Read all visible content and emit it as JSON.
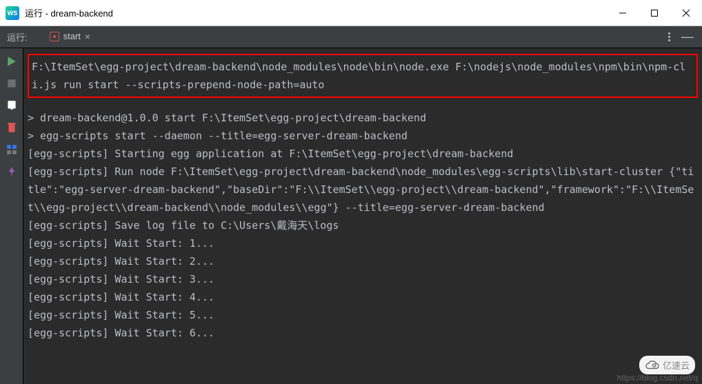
{
  "window": {
    "icon_text": "WS",
    "title": "运行 - dream-backend"
  },
  "tool": {
    "label": "运行:"
  },
  "tab": {
    "label": "start",
    "close": "×"
  },
  "hide_btn": "—",
  "console": {
    "command": "F:\\ItemSet\\egg-project\\dream-backend\\node_modules\\node\\bin\\node.exe F:\\nodejs\\node_modules\\npm\\bin\\npm-cli.js run start --scripts-prepend-node-path=auto",
    "lines": [
      "> dream-backend@1.0.0 start F:\\ItemSet\\egg-project\\dream-backend",
      "> egg-scripts start --daemon --title=egg-server-dream-backend",
      "",
      "[egg-scripts] Starting egg application at F:\\ItemSet\\egg-project\\dream-backend",
      "[egg-scripts] Run node F:\\ItemSet\\egg-project\\dream-backend\\node_modules\\egg-scripts\\lib\\start-cluster {\"title\":\"egg-server-dream-backend\",\"baseDir\":\"F:\\\\ItemSet\\\\egg-project\\\\dream-backend\",\"framework\":\"F:\\\\ItemSet\\\\egg-project\\\\dream-backend\\\\node_modules\\\\egg\"} --title=egg-server-dream-backend",
      "[egg-scripts] Save log file to C:\\Users\\戴海天\\logs",
      "[egg-scripts] Wait Start: 1...",
      "[egg-scripts] Wait Start: 2...",
      "[egg-scripts] Wait Start: 3...",
      "[egg-scripts] Wait Start: 4...",
      "[egg-scripts] Wait Start: 5...",
      "[egg-scripts] Wait Start: 6..."
    ]
  },
  "watermarks": {
    "csdn": "https://blog.csdn.net/q",
    "brand": "亿速云"
  }
}
